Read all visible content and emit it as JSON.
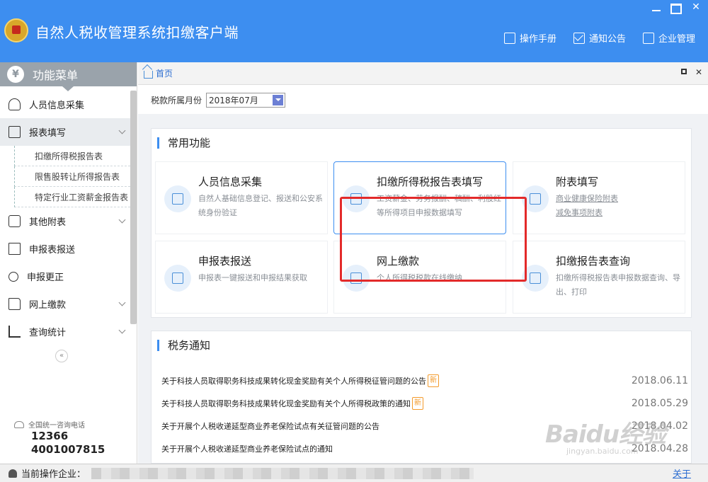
{
  "window": {
    "title": "自然人税收管理系统扣缴客户端",
    "top_links": [
      "操作手册",
      "通知公告",
      "企业管理"
    ]
  },
  "sidebar": {
    "header": "功能菜单",
    "items": [
      {
        "label": "人员信息采集",
        "icon": "person-icon"
      },
      {
        "label": "报表填写",
        "icon": "edit-icon",
        "expanded": true
      },
      {
        "label": "其他附表",
        "icon": "grid-icon"
      },
      {
        "label": "申报表报送",
        "icon": "doc-icon"
      },
      {
        "label": "申报更正",
        "icon": "search-icon"
      },
      {
        "label": "网上缴款",
        "icon": "folder-icon"
      },
      {
        "label": "查询统计",
        "icon": "stats-icon"
      }
    ],
    "subitems": [
      "扣缴所得税报告表",
      "限售股转让所得报告表",
      "特定行业工资薪金报告表"
    ],
    "hotline": {
      "label": "全国统一咨询电话",
      "numbers": [
        "12366",
        "4001007815"
      ]
    }
  },
  "tabs": {
    "home": "首页"
  },
  "filter": {
    "label": "税款所属月份",
    "value": "2018年07月"
  },
  "common": {
    "title": "常用功能",
    "cards": [
      {
        "title": "人员信息采集",
        "desc": "自然人基础信息登记、报送和公安系统身份验证"
      },
      {
        "title": "扣缴所得税报告表填写",
        "desc": "工资薪金、劳务报酬、稿酬、利股红等所得项目申报数据填写"
      },
      {
        "title": "附表填写",
        "links": [
          "商业健康保险附表",
          "减免事项附表"
        ]
      },
      {
        "title": "申报表报送",
        "desc": "申报表一键报送和申报结果获取"
      },
      {
        "title": "网上缴款",
        "desc": "个人所得税税款在线缴纳"
      },
      {
        "title": "扣缴报告表查询",
        "desc": "扣缴所得税报告表申报数据查询、导出、打印"
      }
    ]
  },
  "notice": {
    "title": "税务通知",
    "new_label": "新",
    "rows": [
      {
        "text": "关于科技人员取得职务科技成果转化现金奖励有关个人所得税征管问题的公告",
        "new": true,
        "date": "2018.06.11"
      },
      {
        "text": "关于科技人员取得职务科技成果转化现金奖励有关个人所得税政策的通知",
        "new": true,
        "date": "2018.05.29"
      },
      {
        "text": "关于开展个人税收递延型商业养老保险试点有关征管问题的公告",
        "new": false,
        "date": "2018.04.02"
      },
      {
        "text": "关于开展个人税收递延型商业养老保险试点的通知",
        "new": false,
        "date": "2018.04.28"
      }
    ]
  },
  "status": {
    "label": "当前操作企业：",
    "about": "关于"
  },
  "watermark": {
    "main": "Baidu经验",
    "sub": "jingyan.baidu.com"
  },
  "colors": {
    "titlebar": "#3d8ef0",
    "highlight": "#e32a2a",
    "badge": "#f39b2c"
  }
}
